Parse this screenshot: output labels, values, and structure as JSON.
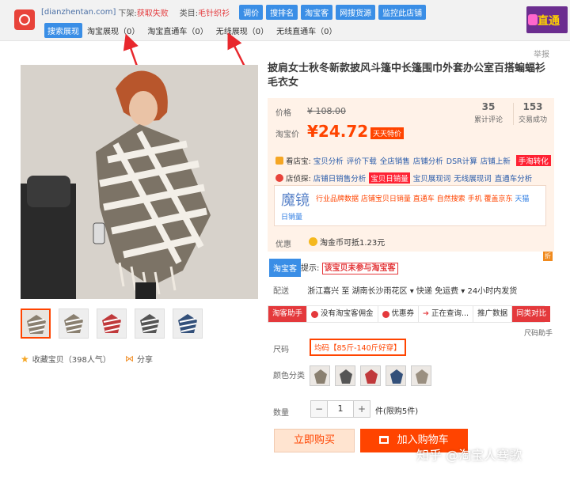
{
  "plugin": {
    "site": "[dianzhentan.com]",
    "download_label": "下架:",
    "download_status": "获取失败",
    "category_label": "类目:",
    "category_value": "毛针织衫",
    "buttons": [
      "调价",
      "搜排名",
      "淘宝客",
      "网搜货源",
      "监控此店铺"
    ],
    "tabs": [
      {
        "label": "搜索展现",
        "active": true
      },
      {
        "label": "淘宝展现（0）",
        "active": false
      },
      {
        "label": "淘宝直通车（0）",
        "active": false
      },
      {
        "label": "无线展现（0）",
        "active": false
      },
      {
        "label": "无线直通车（0）",
        "active": false
      }
    ],
    "banner_text": "直通"
  },
  "report_label": "举报",
  "product": {
    "title": "披肩女士秋冬新款披风斗篷中长篷围巾外套办公室百搭蝙蝠衫毛衣女",
    "price_label": "价格",
    "original_price": "¥ 108.00",
    "tb_price_label": "淘宝价",
    "current_price": "¥24.72",
    "promo_tag": "天天特价",
    "reviews_count": "35",
    "reviews_label": "累计评论",
    "deals_count": "153",
    "deals_label": "交易成功"
  },
  "tools": {
    "shop_label": "看店宝:",
    "shop_links": [
      "宝贝分析",
      "评价下载",
      "全店销售",
      "店铺分析",
      "DSR计算",
      "店铺上新"
    ],
    "shop_tag": "手淘转化",
    "store_label": "店侦探:",
    "store_links": [
      "店铺日销售分析",
      "宝贝日销量",
      "宝贝展现词",
      "无线展现词",
      "直通车分析"
    ],
    "store_highlight": "宝贝日销量",
    "mojing_big": "魔镜",
    "mojing_items": [
      "行业品牌数据",
      "店铺宝贝日销量",
      "直通车",
      "自然搜索",
      "手机",
      "覆盖京东",
      "天猫"
    ],
    "mojing_line2": "日销量"
  },
  "promo": {
    "label": "优惠",
    "coin_text": "淘金币可抵1.23元"
  },
  "tbk": {
    "badge": "淘宝客",
    "hint_label": "提示:",
    "hint_value": "该宝贝未参与淘宝客",
    "corner_icon": "折"
  },
  "delivery": {
    "label": "配送",
    "text": "浙江嘉兴 至   湖南长沙雨花区 ▾   快递 免运费 ▾   24小时内发货"
  },
  "helper_toolbar": [
    {
      "label": "淘客助手",
      "style": "red"
    },
    {
      "label": "没有淘宝客佣金",
      "style": "normal"
    },
    {
      "label": "优惠券",
      "style": "normal"
    },
    {
      "label": "正在查询...",
      "style": "normal"
    },
    {
      "label": "推广数据",
      "style": "normal"
    },
    {
      "label": "同类对比",
      "style": "red2"
    }
  ],
  "size_helper": "尺码助手",
  "sku": {
    "size_label": "尺码",
    "size_value": "均码【85斤-140斤好穿】",
    "color_label": "颜色分类",
    "qty_label": "数量",
    "qty_value": "1",
    "minus": "−",
    "plus": "+",
    "stock": "件(限购5件)"
  },
  "actions": {
    "buy_now": "立即购买",
    "add_cart": "加入购物车"
  },
  "gallery": {
    "fav_text": "收藏宝贝（398人气）",
    "share_text": "分享"
  },
  "watermark": "知乎 @淘宝人骞歌",
  "colors": {
    "accent": "#ff4400",
    "blue": "#3a8ee6",
    "red": "#e4393c"
  }
}
